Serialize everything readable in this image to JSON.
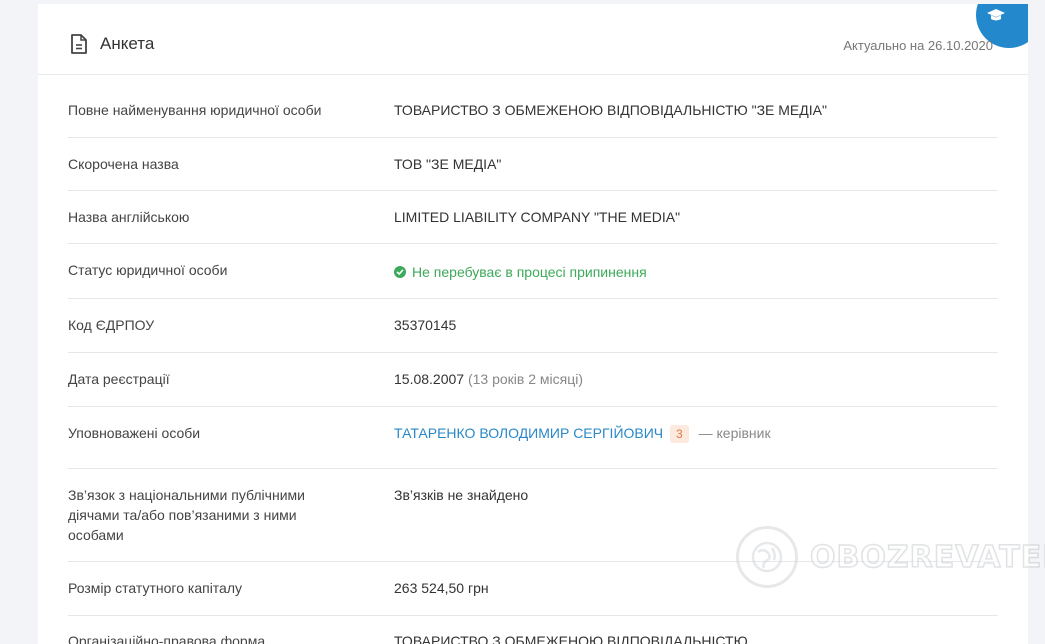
{
  "header": {
    "title": "Анкета",
    "actual_date": "Актуально на 26.10.2020"
  },
  "rows": [
    {
      "label": "Повне найменування юридичної особи",
      "value": "ТОВАРИСТВО З ОБМЕЖЕНОЮ ВІДПОВІДАЛЬНІСТЮ \"ЗЕ МЕДІА\""
    },
    {
      "label": "Скорочена назва",
      "value": "ТОВ \"ЗЕ МЕДІА\""
    },
    {
      "label": "Назва англійською",
      "value": "LIMITED LIABILITY COMPANY \"THE MEDIA\""
    },
    {
      "label": "Статус юридичної особи",
      "value": "Не перебуває в процесі припинення"
    },
    {
      "label": "Код ЄДРПОУ",
      "value": "35370145"
    },
    {
      "label": "Дата реєстрації",
      "value": "15.08.2007",
      "extra": "(13 років 2 місяці)"
    },
    {
      "label": "Уповноважені особи",
      "person": "ТАТАРЕНКО ВОЛОДИМИР СЕРГІЙОВИЧ",
      "badge": "3",
      "role": "— керівник"
    },
    {
      "label": "Зв’язок з національними публічними діячами та/або пов’язаними з ними особами",
      "value": "Зв’язків не знайдено"
    },
    {
      "label": "Розмір статутного капіталу",
      "value": "263 524,50 грн"
    },
    {
      "label": "Організаційно-правова форма",
      "value": "ТОВАРИСТВО З ОБМЕЖЕНОЮ ВІДПОВІДАЛЬНІСТЮ"
    }
  ],
  "watermark": {
    "text": "OBOZREVATEL"
  },
  "colors": {
    "accent": "#2389cc",
    "status_ok": "#3caa5a",
    "link": "#2a88c8"
  }
}
